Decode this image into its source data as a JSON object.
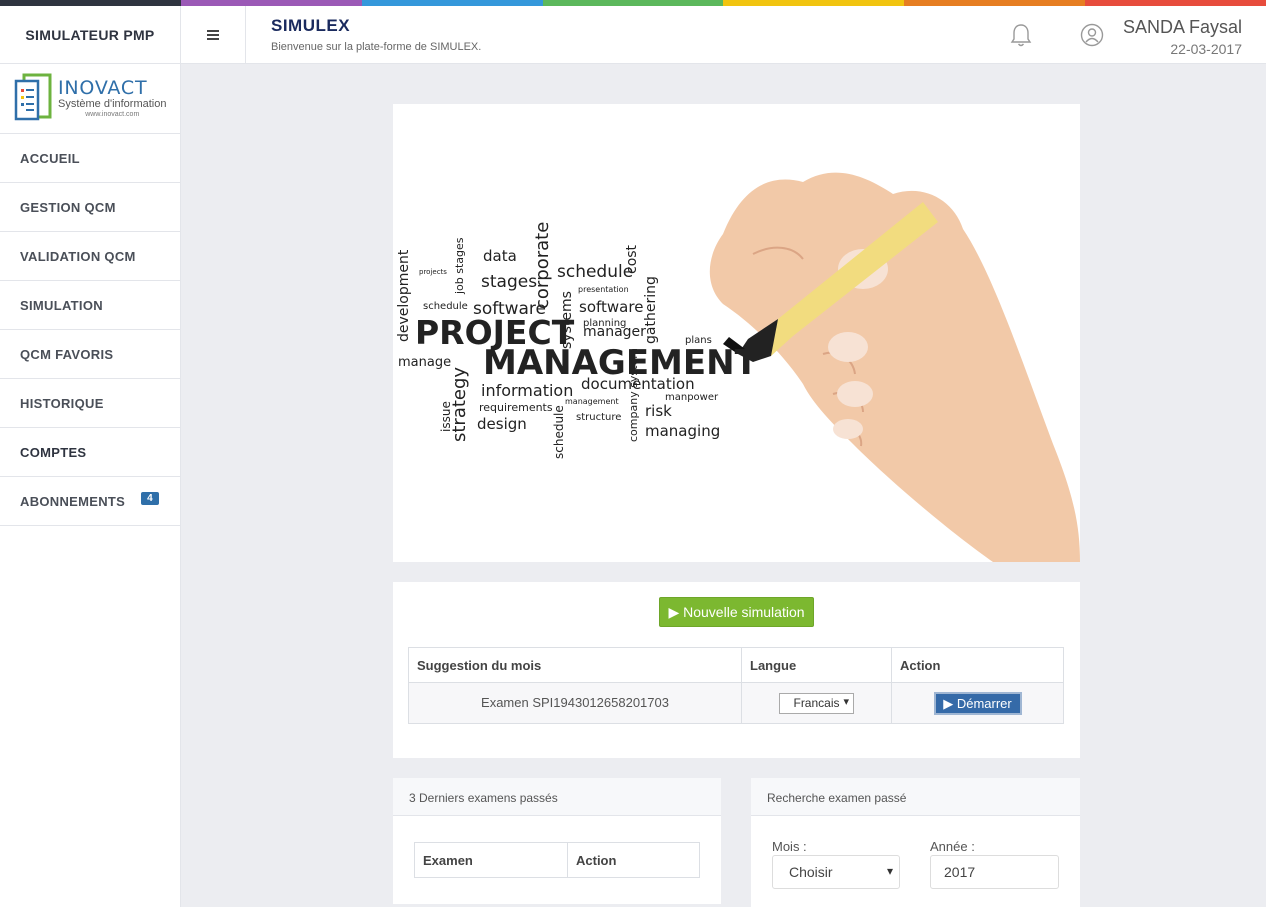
{
  "colorbar": [
    "#2f3440",
    "#9b59b6",
    "#3498db",
    "#5cb85c",
    "#f1c40f",
    "#e67e22",
    "#e74c3c"
  ],
  "header": {
    "brand": "SIMULATEUR PMP",
    "title": "SIMULEX",
    "subtitle": "Bienvenue sur la plate-forme de SIMULEX.",
    "user_name": "SANDA Faysal",
    "date": "22-03-2017"
  },
  "logo": {
    "name": "INOVACT",
    "tagline": "Système d'information",
    "url": "www.inovact.com"
  },
  "sidebar": {
    "items": [
      {
        "label": "ACCUEIL"
      },
      {
        "label": "GESTION QCM"
      },
      {
        "label": "VALIDATION QCM"
      },
      {
        "label": "SIMULATION"
      },
      {
        "label": "QCM FAVORIS"
      },
      {
        "label": "HISTORIQUE"
      },
      {
        "label": "COMPTES"
      },
      {
        "label": "ABONNEMENTS",
        "badge": "4"
      }
    ]
  },
  "hero": {
    "words": [
      "PROJECT",
      "MANAGEMENT",
      "development",
      "strategy",
      "corporate",
      "schedule",
      "software",
      "stages",
      "data",
      "information",
      "documentation",
      "design",
      "risk",
      "managing",
      "manager",
      "planning",
      "systems",
      "gathering",
      "cost",
      "plans",
      "manage",
      "issue",
      "requirements",
      "structure",
      "manpower",
      "presentation",
      "job",
      "plan",
      "projects"
    ]
  },
  "simulation": {
    "new_button": "▶ Nouvelle simulation",
    "table_headers": [
      "Suggestion du mois",
      "Langue",
      "Action"
    ],
    "row": {
      "exam": "Examen SPI1943012658201703",
      "language": "Francais",
      "action": "▶ Démarrer"
    }
  },
  "last_exams": {
    "title": "3 Derniers examens passés",
    "headers": [
      "Examen",
      "Action"
    ]
  },
  "search": {
    "title": "Recherche examen passé",
    "month_label": "Mois :",
    "month_value": "Choisir",
    "year_label": "Année :",
    "year_value": "2017"
  }
}
